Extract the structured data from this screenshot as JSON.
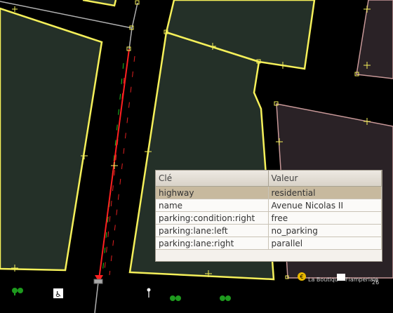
{
  "map": {
    "background": "#000000",
    "building_fill": "#243028",
    "building_outline": "#f5f05a",
    "way_selected_color": "#ff2020",
    "way_other_color": "#b0b0b0",
    "parking_lane_free_color": "#20c020",
    "parking_lane_none_color": "#e02020",
    "pink_outline": "#c89898"
  },
  "tag_table": {
    "headers": {
      "key": "Clé",
      "value": "Valeur"
    },
    "rows": [
      {
        "key": "highway",
        "value": "residential",
        "selected": true
      },
      {
        "key": "name",
        "value": "Avenue Nicolas II",
        "selected": false
      },
      {
        "key": "parking:condition:right",
        "value": "free",
        "selected": false
      },
      {
        "key": "parking:lane:left",
        "value": "no_parking",
        "selected": false
      },
      {
        "key": "parking:lane:right",
        "value": "parallel",
        "selected": false
      }
    ]
  },
  "labels": {
    "shop_label": "La Boutiqu",
    "shop_label_2": "Flamperiale",
    "house_number": "26"
  },
  "icons": [
    "tree-icon",
    "toilets-icon",
    "lamp-icon",
    "shop-icon",
    "bank-icon"
  ]
}
